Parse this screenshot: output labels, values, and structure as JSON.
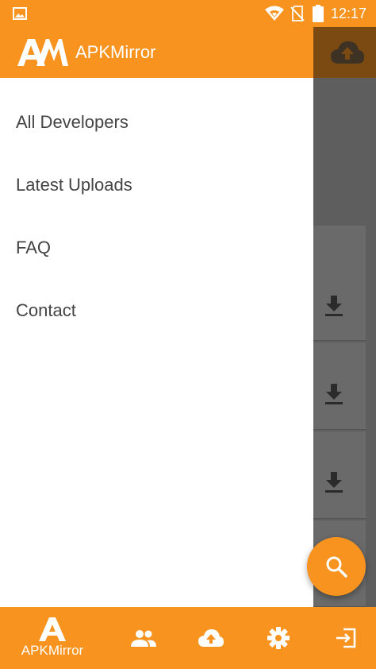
{
  "status_bar": {
    "time": "12:17"
  },
  "app": {
    "name": "APKMirror"
  },
  "drawer": {
    "items": [
      {
        "label": "All Developers"
      },
      {
        "label": "Latest Uploads"
      },
      {
        "label": "FAQ"
      },
      {
        "label": "Contact"
      }
    ]
  },
  "bottom_nav": {
    "apkmirror_label": "APKMirror"
  },
  "colors": {
    "accent": "#f7931e",
    "scrim": "#5e5e5e",
    "drawer_bg": "#ffffff",
    "menu_text": "#444444"
  }
}
